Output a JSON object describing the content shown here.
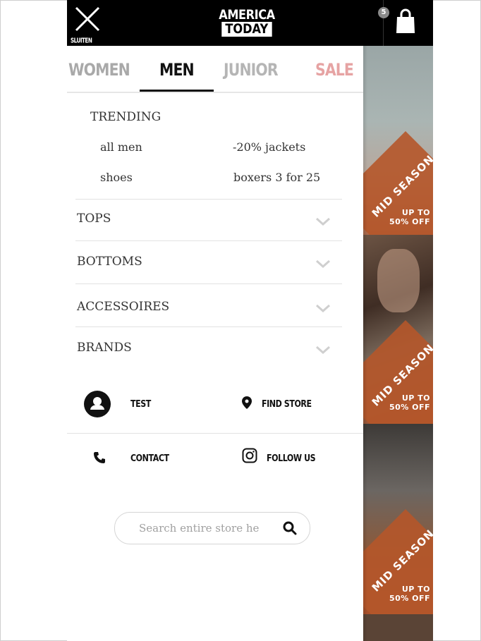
{
  "header": {
    "close_label": "SLUITEN",
    "logo_line1": "AMERICA",
    "logo_line2": "TODAY",
    "cart_count": "5"
  },
  "tabs": [
    {
      "label": "WOMEN",
      "active": false
    },
    {
      "label": "MEN",
      "active": true
    },
    {
      "label": "JUNIOR",
      "active": false
    },
    {
      "label": "SALE",
      "active": false,
      "color": "#e6a3a3"
    }
  ],
  "trending": {
    "title": "TRENDING",
    "links": [
      "all men",
      "-20% jackets",
      "shoes",
      "boxers 3 for 25"
    ]
  },
  "categories": [
    "TOPS",
    "BOTTOMS",
    "ACCESSOIRES",
    "BRANDS"
  ],
  "utility": {
    "account_label": "TEST",
    "find_store_label": "FIND STORE",
    "contact_label": "CONTACT",
    "follow_label": "FOLLOW US"
  },
  "search": {
    "placeholder": "Search entire store he"
  },
  "banners": [
    {
      "diag_text": "MID SEASON",
      "promo_line1": "UP TO",
      "promo_line2": "50% OFF"
    },
    {
      "diag_text": "MID SEASON",
      "promo_line1": "UP TO",
      "promo_line2": "50% OFF"
    },
    {
      "diag_text": "MID SEASON",
      "promo_line1": "UP TO",
      "promo_line2": "50% OFF"
    }
  ],
  "colors": {
    "header_bg": "#000000",
    "sale_tab": "#e6a3a3",
    "banner_orange": "#b5562a"
  },
  "icons": [
    "close-icon",
    "shopping-bag-icon",
    "user-icon",
    "map-pin-icon",
    "phone-icon",
    "instagram-icon",
    "search-icon",
    "chevron-down-icon"
  ]
}
